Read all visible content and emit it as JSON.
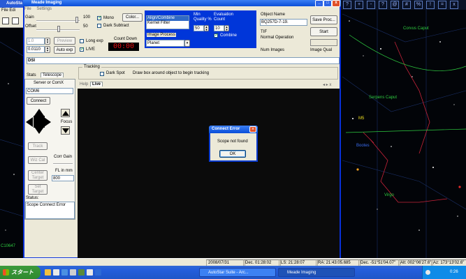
{
  "colors": {
    "accent": "#0036d9",
    "countdown": "#e31010",
    "chart_green": "#2ecc40"
  },
  "background": {
    "title": "AutoSta",
    "menu": "File  Edi",
    "sky_labels": [
      "Corvus Caput",
      "Serpens Caput",
      "Virgo",
      "M5",
      "Bootes",
      "C10647"
    ],
    "top_icons": [
      "?",
      "+",
      "-",
      "?",
      "@",
      "#",
      "%",
      "!",
      "=",
      "x"
    ]
  },
  "window": {
    "title": "Meade Imaging",
    "controls": [
      "_",
      "□",
      "x"
    ],
    "menu": [
      "File",
      "Settings"
    ],
    "exposure": {
      "gain_label": "Gain",
      "gain_value": "100",
      "offset_label": "Offset",
      "offset_value": "50",
      "mono_label": "Mono",
      "dark_subtract_label": "Dark Subtract",
      "color_button": "Color...",
      "exposure_value": "1.0",
      "exposure_time": "0.0110",
      "preview_button": "Preview",
      "auto_exp_button": "Auto exp",
      "long_exp_label": "Long exp",
      "live_label": "LIVE",
      "countdown_label": "Count Down",
      "countdown_value": "00:00"
    },
    "image_process": {
      "filters": [
        "Align/Combine",
        "Kernel Filter"
      ],
      "image_process_label": "Image Process",
      "image_process_value": "Planet",
      "min_quality_label": "Min Quality %",
      "min_quality_value": "50",
      "evaluation_count_label": "Evaluation Count",
      "evaluation_count_value": "10",
      "combine_label": "Combine"
    },
    "object": {
      "name_label": "Object Name",
      "name_value": "BQ257D-7-19.",
      "save_proc_button": "Save Proc...",
      "start_button": "Start",
      "format": "TIF",
      "operation": "Normal Operation",
      "num_images_label": "Num Images",
      "image_qual_label": "Image Qual"
    },
    "dsi_label": "DSI",
    "tracking": {
      "group_label": "Tracking",
      "dark_spot_label": "Dark Spot",
      "hint": "Draw box around object to begin tracking"
    },
    "telescope": {
      "tabs": [
        "Stats",
        "Telescope"
      ],
      "server_label": "Server or ComX",
      "com_value": "COM6",
      "connect_button": "Connect",
      "focus_label": "Focus",
      "track_button": "Track",
      "wiz_cal_button": "Wiz Cal",
      "corr_gain_label": "Corr Gain",
      "fl_label": "FL in mm",
      "fl_value": "800",
      "center_target_button": "Center Target",
      "set_target_button": "Set Target",
      "status_label": "Status:",
      "status_value": "Scope Connect Error"
    },
    "view_tabs": [
      "Help",
      "Live"
    ],
    "scroll_arrows": "◂ ▸ x"
  },
  "dialog": {
    "title": "Connect Error",
    "message": "Scope not found",
    "ok_button": "OK"
  },
  "statusbar": {
    "date": "2008/07/31",
    "dec_a": "Dec. 01:28:02",
    "time": "LS: 21:28:07",
    "ra": "RA: 21:43:05.685",
    "dec": "Dec. -51°51'04.07\"",
    "alt": "Alt: 002°06'27.6\"",
    "az": "Az: 173°13'02.6\""
  },
  "taskbar": {
    "start": "スタート",
    "items": [
      "AutoStar Suite - Arc...",
      "Meade Imaging"
    ],
    "clock": "0:26"
  }
}
